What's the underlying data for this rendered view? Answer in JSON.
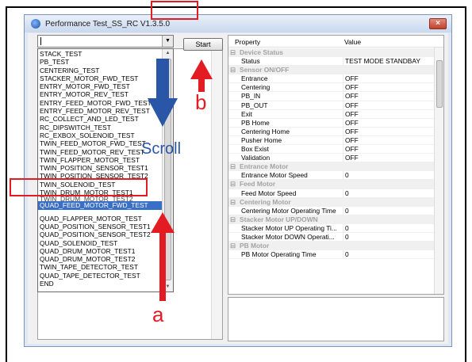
{
  "window": {
    "title": "Performance Test_SS_RC V1.3.5.0",
    "close_glyph": "×"
  },
  "combo": {
    "value": "",
    "arrow_glyph": "▼"
  },
  "dropdown": {
    "items_above": [
      "STACK_TEST",
      "PB_TEST",
      "CENTERING_TEST",
      "STACKER_MOTOR_FWD_TEST",
      "ENTRY_MOTOR_FWD_TEST",
      "ENTRY_MOTOR_REV_TEST",
      "ENTRY_FEED_MOTOR_FWD_TEST",
      "ENTRY_FEED_MOTOR_REV_TEST",
      "RC_COLLECT_AND_LED_TEST",
      "RC_DIPSWITCH_TEST",
      "RC_EXBOX_SOLENOID_TEST",
      "TWIN_FEED_MOTOR_FWD_TEST",
      "TWIN_FEED_MOTOR_REV_TEST",
      "TWIN_FLAPPER_MOTOR_TEST",
      "TWIN_POSITION_SENSOR_TEST1",
      "TWIN_POSITION_SENSOR_TEST2",
      "TWIN_SOLENOID_TEST",
      "TWIN_DRUM_MOTOR_TEST1"
    ],
    "cut_item": "TWIN_DRUM_MOTOR_TEST2",
    "selected_item": "QUAD_FEED_MOTOR_FWD_TEST",
    "items_below": [
      "QUAD_FLAPPER_MOTOR_TEST",
      "QUAD_POSITION_SENSOR_TEST1",
      "QUAD_POSITION_SENSOR_TEST2",
      "QUAD_SOLENOID_TEST",
      "QUAD_DRUM_MOTOR_TEST1",
      "QUAD_DRUM_MOTOR_TEST2",
      "TWIN_TAPE_DETECTOR_TEST",
      "QUAD_TAPE_DETECTOR_TEST",
      "END"
    ]
  },
  "toolbar": {
    "start_label": "Start"
  },
  "property_grid": {
    "header_property": "Property",
    "header_value": "Value",
    "rows": [
      {
        "kind": "cat",
        "label": "Device Status"
      },
      {
        "kind": "prop",
        "name": "Status",
        "value": "TEST MODE STANDBAY"
      },
      {
        "kind": "cat",
        "label": "Sensor ON/OFF"
      },
      {
        "kind": "prop",
        "name": "Entrance",
        "value": "OFF"
      },
      {
        "kind": "prop",
        "name": "Centering",
        "value": "OFF"
      },
      {
        "kind": "prop",
        "name": "PB_IN",
        "value": "OFF"
      },
      {
        "kind": "prop",
        "name": "PB_OUT",
        "value": "OFF"
      },
      {
        "kind": "prop",
        "name": "Exit",
        "value": "OFF"
      },
      {
        "kind": "prop",
        "name": "PB Home",
        "value": "OFF"
      },
      {
        "kind": "prop",
        "name": "Centering Home",
        "value": "OFF"
      },
      {
        "kind": "prop",
        "name": "Pusher Home",
        "value": "OFF"
      },
      {
        "kind": "prop",
        "name": "Box Exist",
        "value": "OFF"
      },
      {
        "kind": "prop",
        "name": "Validation",
        "value": "OFF"
      },
      {
        "kind": "cat",
        "label": "Entrance Motor"
      },
      {
        "kind": "prop",
        "name": "Entrance Motor Speed",
        "value": "0"
      },
      {
        "kind": "cat",
        "label": "Feed Motor"
      },
      {
        "kind": "prop",
        "name": "Feed Motor Speed",
        "value": "0"
      },
      {
        "kind": "cat",
        "label": "Centering Motor"
      },
      {
        "kind": "prop",
        "name": "Centering Motor Operating Time",
        "value": "0"
      },
      {
        "kind": "cat",
        "label": "Stacker Motor UP/DOWN"
      },
      {
        "kind": "prop",
        "name": "Stacker Motor UP Operating Ti...",
        "value": "0"
      },
      {
        "kind": "prop",
        "name": "Stacker Motor DOWN Operati...",
        "value": "0"
      },
      {
        "kind": "cat",
        "label": "PB Motor"
      },
      {
        "kind": "prop",
        "name": "PB Motor Operating Time",
        "value": "0"
      }
    ],
    "collapse_glyph": "⊟"
  },
  "annotations": {
    "label_a": "a",
    "label_b": "b",
    "scroll_label": "Scroll",
    "red": "#e31b23",
    "blue": "#2a56a8"
  }
}
